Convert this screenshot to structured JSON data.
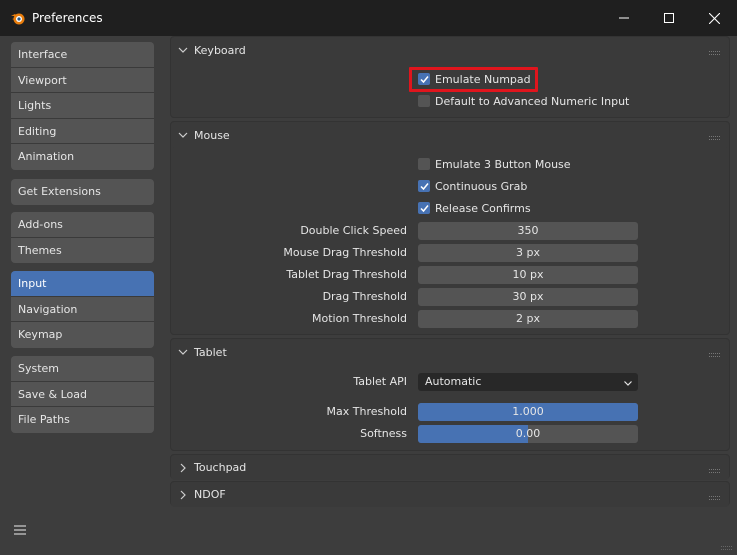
{
  "window": {
    "title": "Preferences"
  },
  "sidebar": {
    "groups": [
      [
        "Interface",
        "Viewport",
        "Lights",
        "Editing",
        "Animation"
      ],
      [
        "Get Extensions"
      ],
      [
        "Add-ons",
        "Themes"
      ],
      [
        "Input",
        "Navigation",
        "Keymap"
      ],
      [
        "System",
        "Save & Load",
        "File Paths"
      ]
    ],
    "active": "Input"
  },
  "keyboard": {
    "title": "Keyboard",
    "emulate_numpad": {
      "label": "Emulate Numpad",
      "checked": true
    },
    "advanced_numeric": {
      "label": "Default to Advanced Numeric Input",
      "checked": false
    }
  },
  "mouse": {
    "title": "Mouse",
    "emulate_3_button": {
      "label": "Emulate 3 Button Mouse",
      "checked": false
    },
    "continuous_grab": {
      "label": "Continuous Grab",
      "checked": true
    },
    "release_confirms": {
      "label": "Release Confirms",
      "checked": true
    },
    "fields": [
      {
        "label": "Double Click Speed",
        "value": "350"
      },
      {
        "label": "Mouse Drag Threshold",
        "value": "3 px"
      },
      {
        "label": "Tablet Drag Threshold",
        "value": "10 px"
      },
      {
        "label": "Drag Threshold",
        "value": "30 px"
      },
      {
        "label": "Motion Threshold",
        "value": "2 px"
      }
    ]
  },
  "tablet": {
    "title": "Tablet",
    "api_label": "Tablet API",
    "api_value": "Automatic",
    "max_threshold": {
      "label": "Max Threshold",
      "value": "1.000",
      "fraction": 1.0
    },
    "softness": {
      "label": "Softness",
      "value": "0.00",
      "fraction": 0.5
    }
  },
  "touchpad": {
    "title": "Touchpad"
  },
  "ndof": {
    "title": "NDOF"
  },
  "colors": {
    "accent": "#4772b3",
    "highlight": "#e0151d"
  }
}
